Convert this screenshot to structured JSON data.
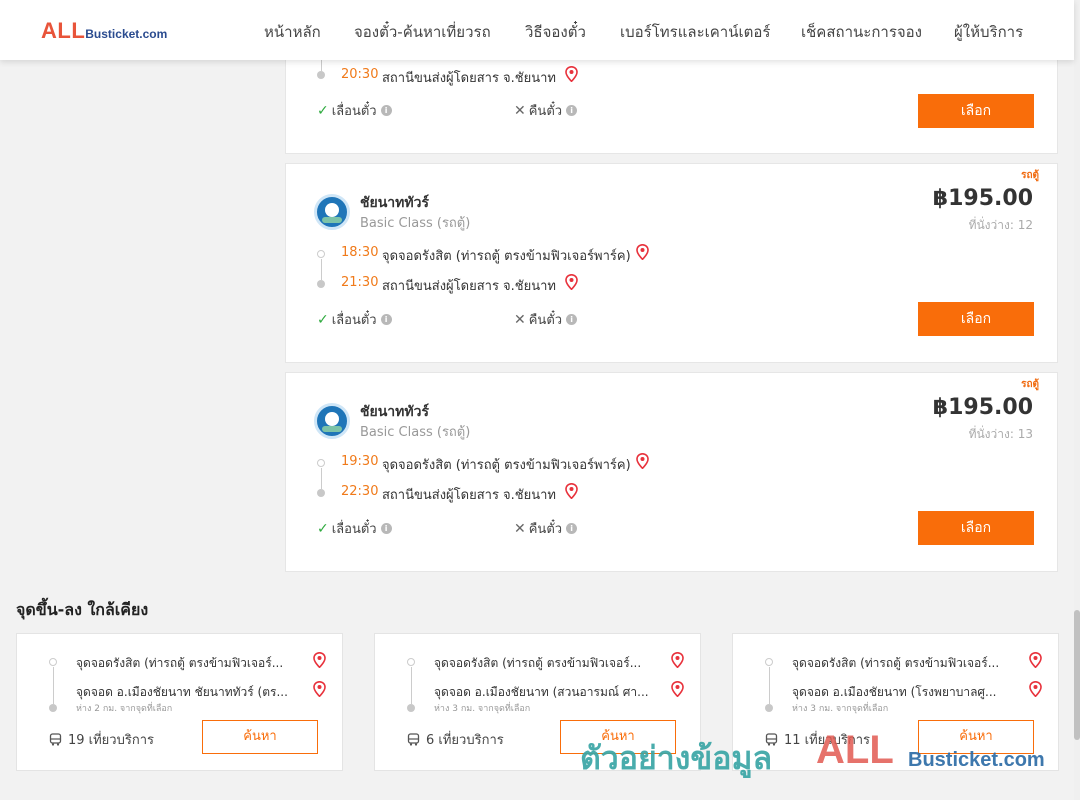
{
  "header": {
    "logo_all": "ALL",
    "logo_rest": "Busticket.com",
    "nav": [
      "หน้าหลัก",
      "จองตั๋ว-ค้นหาเที่ยวรถ",
      "วิธีจองตั๋ว",
      "เบอร์โทรและเคาน์เตอร์",
      "เช็คสถานะการจอง",
      "ผู้ให้บริการ"
    ]
  },
  "trips": [
    {
      "arrive_time": "20:30",
      "arrive_place": "สถานีขนส่งผู้โดยสาร จ.ชัยนาท",
      "reschedule": "เลื่อนตั๋ว",
      "refund": "คืนตั๋ว",
      "select_label": "เลือก"
    },
    {
      "badge": "รถตู้",
      "operator": "ชัยนาททัวร์",
      "class": "Basic Class (รถตู้)",
      "price": "฿195.00",
      "seats": "ที่นั่งว่าง: 12",
      "depart_time": "18:30",
      "depart_place": "จุดจอดรังสิต (ท่ารถตู้ ตรงข้ามฟิวเจอร์พาร์ค)",
      "arrive_time": "21:30",
      "arrive_place": "สถานีขนส่งผู้โดยสาร จ.ชัยนาท",
      "reschedule": "เลื่อนตั๋ว",
      "refund": "คืนตั๋ว",
      "select_label": "เลือก"
    },
    {
      "badge": "รถตู้",
      "operator": "ชัยนาททัวร์",
      "class": "Basic Class (รถตู้)",
      "price": "฿195.00",
      "seats": "ที่นั่งว่าง: 13",
      "depart_time": "19:30",
      "depart_place": "จุดจอดรังสิต (ท่ารถตู้ ตรงข้ามฟิวเจอร์พาร์ค)",
      "arrive_time": "22:30",
      "arrive_place": "สถานีขนส่งผู้โดยสาร จ.ชัยนาท",
      "reschedule": "เลื่อนตั๋ว",
      "refund": "คืนตั๋ว",
      "select_label": "เลือก"
    }
  ],
  "nearby": {
    "title": "จุดขึ้น-ลง ใกล้เคียง",
    "cards": [
      {
        "from": "จุดจอดรังสิต (ท่ารถตู้ ตรงข้ามฟิวเจอร์...",
        "to": "จุดจอด อ.เมืองชัยนาท ชัยนาททัวร์ (ตร...",
        "distance": "ห่าง 2 กม. จากจุดที่เลือก",
        "trips": "19 เที่ยวบริการ",
        "search_label": "ค้นหา"
      },
      {
        "from": "จุดจอดรังสิต (ท่ารถตู้ ตรงข้ามฟิวเจอร์...",
        "to": "จุดจอด อ.เมืองชัยนาท (สวนอารมณ์ ศา...",
        "distance": "ห่าง 3 กม. จากจุดที่เลือก",
        "trips": "6 เที่ยวบริการ",
        "search_label": "ค้นหา"
      },
      {
        "from": "จุดจอดรังสิต (ท่ารถตู้ ตรงข้ามฟิวเจอร์...",
        "to": "จุดจอด อ.เมืองชัยนาท (โรงพยาบาลศู...",
        "distance": "ห่าง 3 กม. จากจุดที่เลือก",
        "trips": "11 เที่ยวบริการ",
        "search_label": "ค้นหา"
      }
    ]
  },
  "watermark": {
    "thai": "ตัวอย่างข้อมูล",
    "all": "ALL",
    "rest": "Busticket.com"
  },
  "colors": {
    "accent": "#f96d0a",
    "time": "#f07a1a",
    "check": "#2eaa3e",
    "pin": "#e8323c"
  }
}
